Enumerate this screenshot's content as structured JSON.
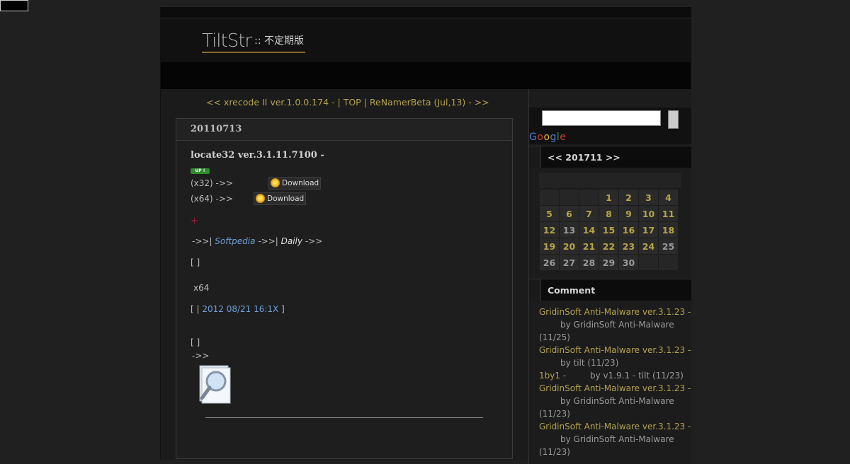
{
  "header": {
    "logo_main": "TiltStr",
    "logo_sub": ":: 不定期版"
  },
  "nav": {
    "prev": "<< xrecode II ver.1.0.0.174 - ",
    "sep1": " | ",
    "top": "TOP",
    "sep2": " | ",
    "next": "ReNamerBeta (Jul,13) - ",
    "next_arrow": " >>"
  },
  "post": {
    "date": "20110713",
    "title": "locate32 ver.3.1.11.7100 -",
    "badge": "UP !",
    "x32_label": "(x32) ->>",
    "x64_label": "(x64) ->>",
    "download_label": "Download",
    "plus": "+",
    "links_prefix": "->>| ",
    "softpedia": "Softpedia",
    "links_mid": " ->>| ",
    "daily": "Daily",
    "links_suffix": " ->>",
    "bracket1": "[  ]",
    "x64_text": "x64",
    "bracket2_pre": "[  |    ",
    "timestamp": "2012 08/21 16:1X",
    "bracket2_post": " ]",
    "bracket3": "[  ]",
    "arrow2": "->>"
  },
  "sidebar": {
    "search_placeholder": "",
    "google": [
      "G",
      "o",
      "o",
      "g",
      "l",
      "e"
    ],
    "calendar_head": "<<  201711  >>",
    "calendar_rows": [
      [
        "",
        "",
        "",
        "1",
        "2",
        "3",
        "4"
      ],
      [
        "5",
        "6",
        "7",
        "8",
        "9",
        "10",
        "11"
      ],
      [
        "12",
        "13",
        "14",
        "15",
        "16",
        "17",
        "18"
      ],
      [
        "19",
        "20",
        "21",
        "22",
        "23",
        "24",
        "25"
      ],
      [
        "26",
        "27",
        "28",
        "29",
        "30",
        "",
        ""
      ]
    ],
    "comment_head": "Comment",
    "comments": [
      {
        "title": "GridinSoft Anti-Malware ver.3.1.23 - ",
        "by": "by GridinSoft Anti-Malware (11/25)"
      },
      {
        "title": "GridinSoft Anti-Malware ver.3.1.23 - ",
        "by": "by tilt (11/23)"
      },
      {
        "title": "1by1 - ",
        "by": "by v1.9.1 - tilt (11/23)"
      },
      {
        "title": "GridinSoft Anti-Malware ver.3.1.23 - ",
        "by": "by GridinSoft Anti-Malware (11/23)"
      },
      {
        "title": "GridinSoft Anti-Malware ver.3.1.23 - ",
        "by": "by GridinSoft Anti-Malware (11/23)"
      }
    ]
  }
}
